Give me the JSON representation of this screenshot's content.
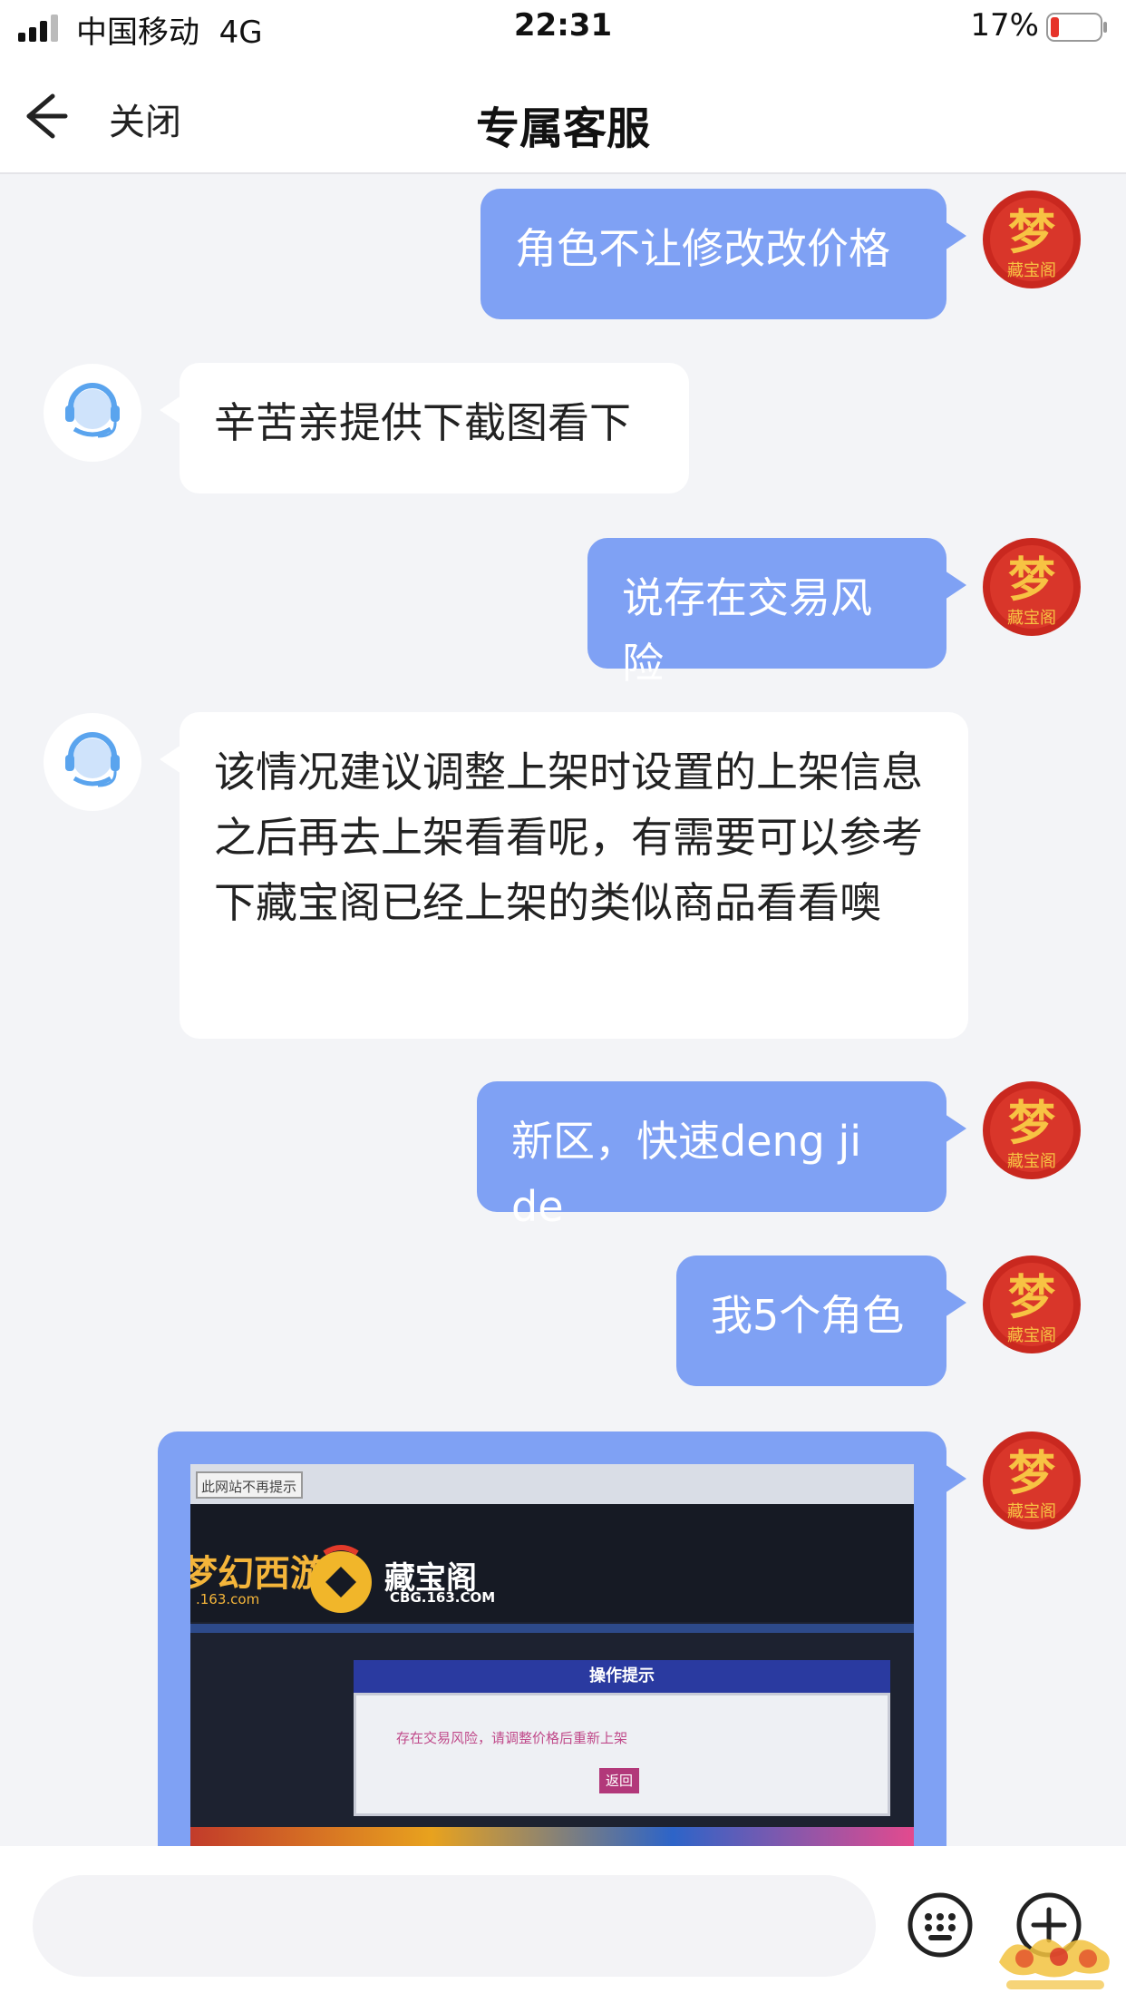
{
  "status_bar": {
    "carrier": "中国移动",
    "network": "4G",
    "time": "22:31",
    "battery": "17%"
  },
  "nav": {
    "close_label": "关闭",
    "title": "专属客服"
  },
  "messages": [
    {
      "side": "out",
      "text": "角色不让修改改价格"
    },
    {
      "side": "in",
      "text": "辛苦亲提供下截图看下"
    },
    {
      "side": "out",
      "text": "说存在交易风险"
    },
    {
      "side": "in",
      "text": "该情况建议调整上架时设置的上架信息之后再去上架看看呢，有需要可以参考下藏宝阁已经上架的类似商品看看噢"
    },
    {
      "side": "out",
      "text": "新区，快速deng ji de"
    },
    {
      "side": "out",
      "text": "我5个角色"
    }
  ],
  "image_message": {
    "tip": "此网站不再提示",
    "game_logo": "梦幻西游",
    "game_url": ".163.com",
    "site_name": "藏宝阁",
    "site_url": "CBG.163.COM",
    "dialog_title": "操作提示",
    "dialog_message": "存在交易风险，请调整价格后重新上架",
    "dialog_button": "返回"
  },
  "avatar_user_text": "梦",
  "avatar_user_sub": "藏宝阁",
  "input": {
    "placeholder": ""
  },
  "colors": {
    "outgoing_bubble": "#7fa1f4",
    "incoming_bubble": "#ffffff",
    "background": "#f3f4f7"
  }
}
